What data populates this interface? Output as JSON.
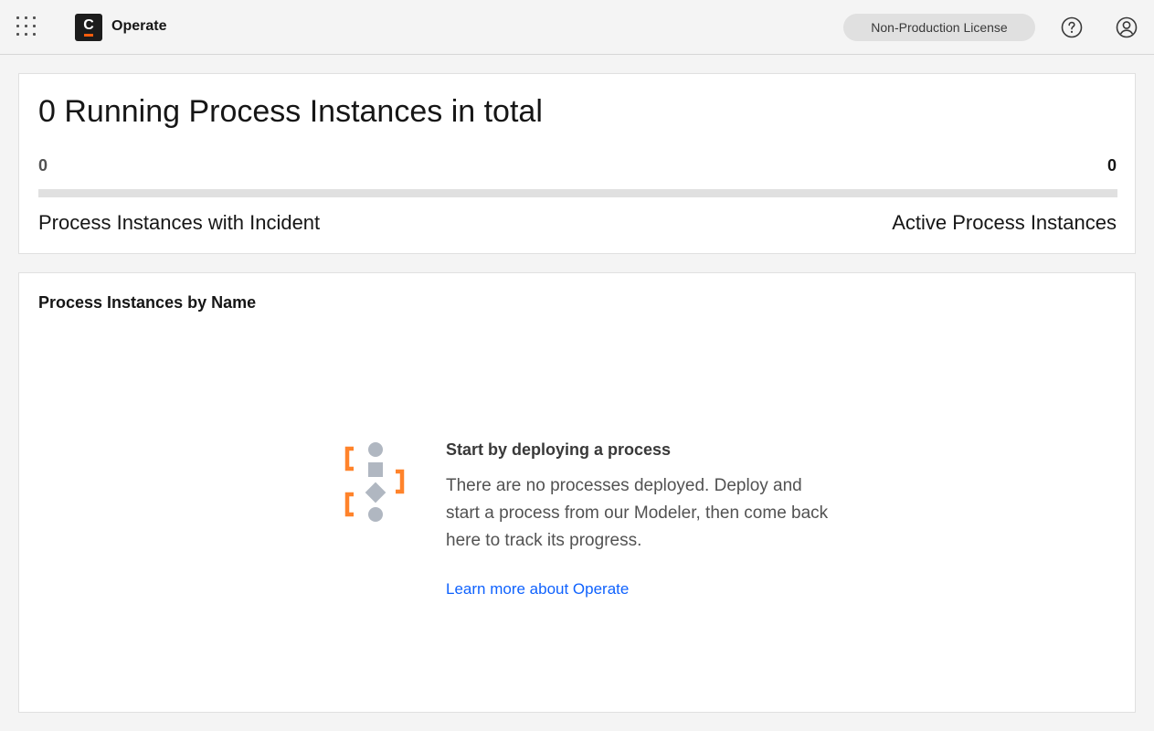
{
  "header": {
    "app_name": "Operate",
    "logo_letter": "C",
    "license_tag": "Non-Production License",
    "icons": {
      "app_switcher": "grid-icon",
      "help": "help-icon",
      "user": "user-icon"
    },
    "brand_accent": "#fc5d0d"
  },
  "summary": {
    "title": "0 Running Process Instances in total",
    "incident_count": "0",
    "active_count": "0",
    "incident_label": "Process Instances with Incident",
    "active_label": "Active Process Instances",
    "incident_fraction": 0
  },
  "by_name": {
    "title": "Process Instances by Name",
    "empty_state": {
      "heading": "Start by deploying a process",
      "body": "There are no processes deployed. Deploy and start a process from our Modeler, then come back here to track its progress.",
      "link": "Learn more about Operate",
      "icon": "process-diagram-icon"
    }
  },
  "colors": {
    "incident": "#da1e28",
    "link": "#0f62fe",
    "illustration_orange": "#ff832b",
    "illustration_gray": "#b0b7c1"
  }
}
